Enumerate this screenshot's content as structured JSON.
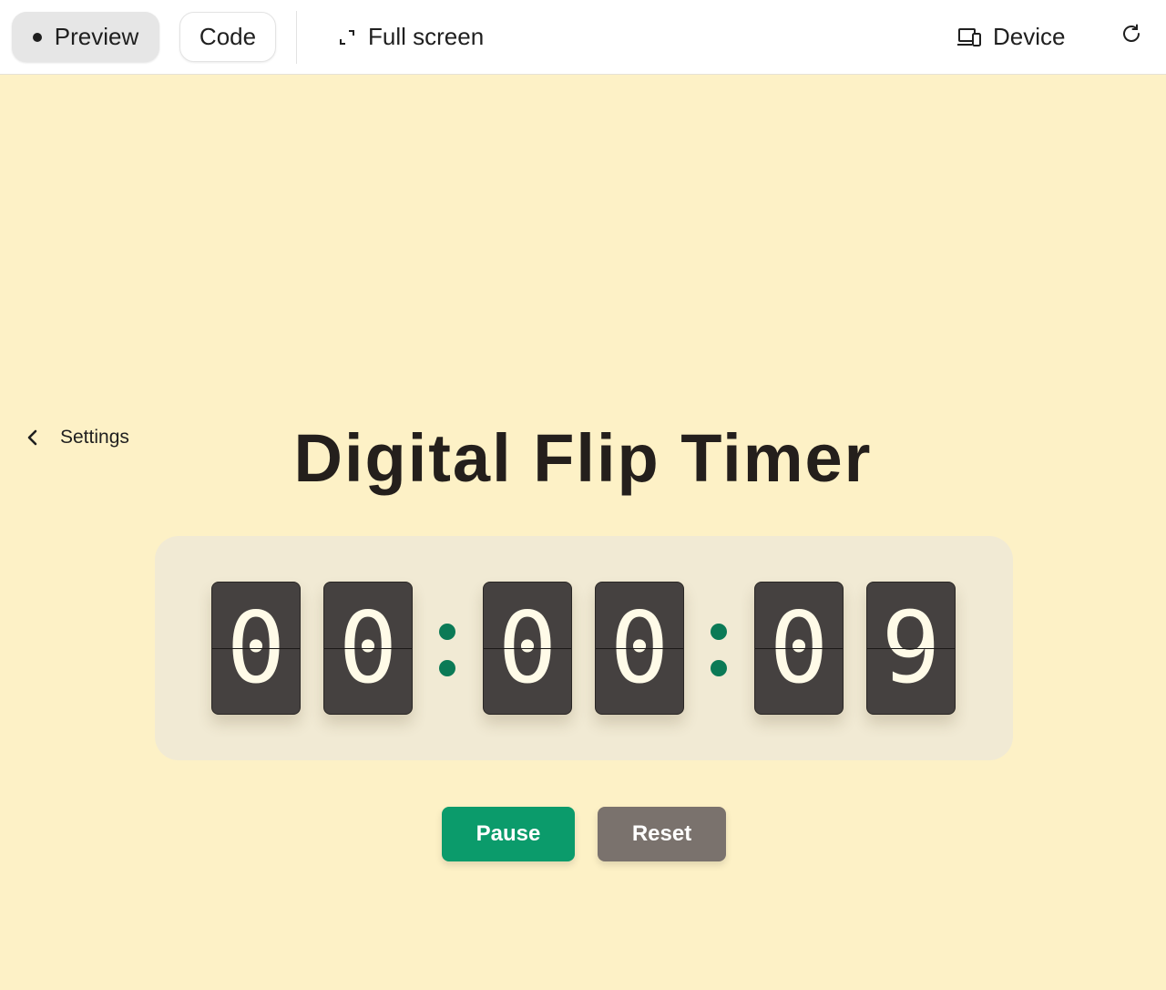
{
  "toolbar": {
    "preview_label": "Preview",
    "code_label": "Code",
    "fullscreen_label": "Full screen",
    "device_label": "Device"
  },
  "settings_label": "Settings",
  "title": "Digital Flip Timer",
  "timer": {
    "hours": [
      "0",
      "0"
    ],
    "minutes": [
      "0",
      "0"
    ],
    "seconds": [
      "0",
      "9"
    ]
  },
  "buttons": {
    "pause_label": "Pause",
    "reset_label": "Reset"
  },
  "colors": {
    "background": "#fdf1c6",
    "panel": "#f1ead4",
    "card": "#454140",
    "digit": "#fffbe8",
    "colon": "#0b7a56",
    "pause": "#0b9b6b",
    "reset": "#7a726d"
  },
  "icons": {
    "preview": "dot-icon",
    "fullscreen": "expand-icon",
    "device": "devices-icon",
    "refresh": "refresh-icon",
    "settings": "chevron-left-icon"
  }
}
